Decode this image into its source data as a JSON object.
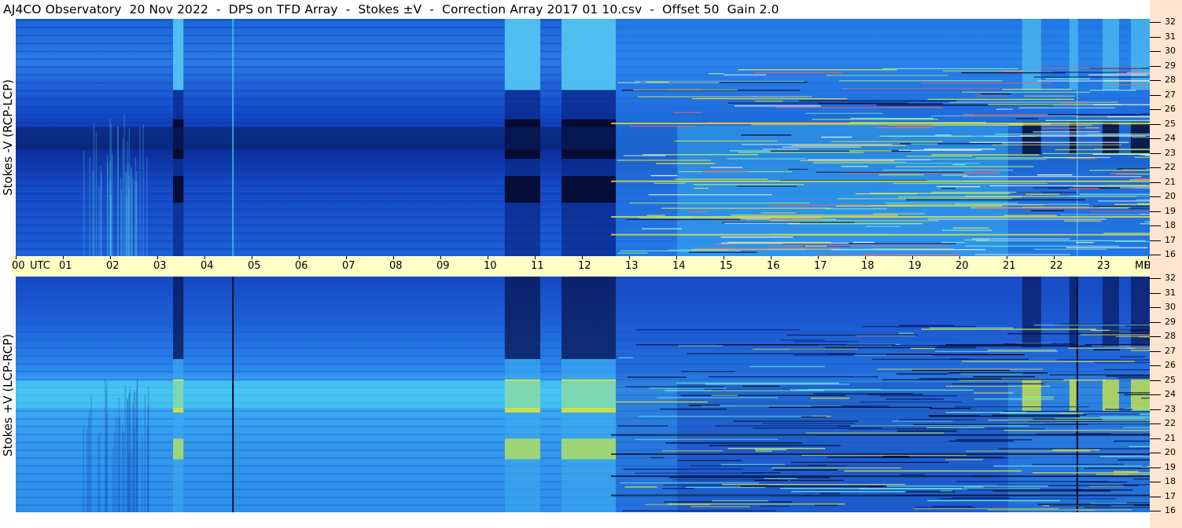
{
  "title": "AJ4CO Observatory  20 Nov 2022  -  DPS on TFD Array  -  Stokes ±V  -  Correction Array 2017 01 10.csv  -  Offset 50  Gain 2.0",
  "colors": {
    "background_top": "#1f5fd9",
    "background_bottom": "#2f9bf0",
    "dark_band": "#040a2a",
    "yellow_band": "#e8e53a",
    "time_axis_bg": "#ffffc8",
    "freq_axis_bg": "#ffe4cf"
  },
  "chart_data": [
    {
      "type": "heatmap",
      "title": "Stokes -V (RCP-LCP)",
      "ylabel": "Stokes -V (RCP-LCP)",
      "x_label": "UTC",
      "y_unit": "MHz",
      "x_ticks": [
        "00",
        "01",
        "02",
        "03",
        "04",
        "05",
        "06",
        "07",
        "08",
        "09",
        "10",
        "11",
        "12",
        "13",
        "14",
        "15",
        "16",
        "17",
        "18",
        "19",
        "20",
        "21",
        "22",
        "23",
        "00"
      ],
      "y_ticks": [
        "32",
        "31",
        "30",
        "29",
        "28",
        "27",
        "26",
        "25",
        "24",
        "23",
        "22",
        "21",
        "20",
        "19",
        "18",
        "17",
        "16"
      ],
      "xlim": [
        0,
        24
      ],
      "ylim": [
        16,
        32
      ],
      "features": [
        {
          "kind": "dark_column",
          "x_start": 3.33,
          "x_end": 3.55
        },
        {
          "kind": "dark_column",
          "x_start": 10.35,
          "x_end": 11.1
        },
        {
          "kind": "dark_column",
          "x_start": 11.55,
          "x_end": 12.7
        },
        {
          "kind": "dark_band_freq",
          "y_start": 23.2,
          "y_end": 24.7
        },
        {
          "kind": "interference_region",
          "x_start": 12.7,
          "x_end": 24
        }
      ]
    },
    {
      "type": "heatmap",
      "title": "Stokes +V (LCP-RCP)",
      "ylabel": "Stokes +V (LCP-RCP)",
      "x_label": "UTC",
      "y_unit": "MHz",
      "x_ticks": [
        "00",
        "01",
        "02",
        "03",
        "04",
        "05",
        "06",
        "07",
        "08",
        "09",
        "10",
        "11",
        "12",
        "13",
        "14",
        "15",
        "16",
        "17",
        "18",
        "19",
        "20",
        "21",
        "22",
        "23",
        "00"
      ],
      "y_ticks": [
        "32",
        "31",
        "30",
        "29",
        "28",
        "27",
        "26",
        "25",
        "24",
        "23",
        "22",
        "21",
        "20",
        "19",
        "18",
        "17",
        "16"
      ],
      "xlim": [
        0,
        24
      ],
      "ylim": [
        16,
        32
      ],
      "features": [
        {
          "kind": "bright_column",
          "x_start": 3.33,
          "x_end": 3.55
        },
        {
          "kind": "bright_column",
          "x_start": 10.35,
          "x_end": 11.1
        },
        {
          "kind": "bright_column",
          "x_start": 11.55,
          "x_end": 12.7
        },
        {
          "kind": "bright_band_freq",
          "y_start": 23.2,
          "y_end": 24.7
        },
        {
          "kind": "interference_region",
          "x_start": 12.7,
          "x_end": 24
        }
      ]
    }
  ],
  "axis_labels": {
    "utc": "UTC",
    "mhz": "MHz"
  }
}
